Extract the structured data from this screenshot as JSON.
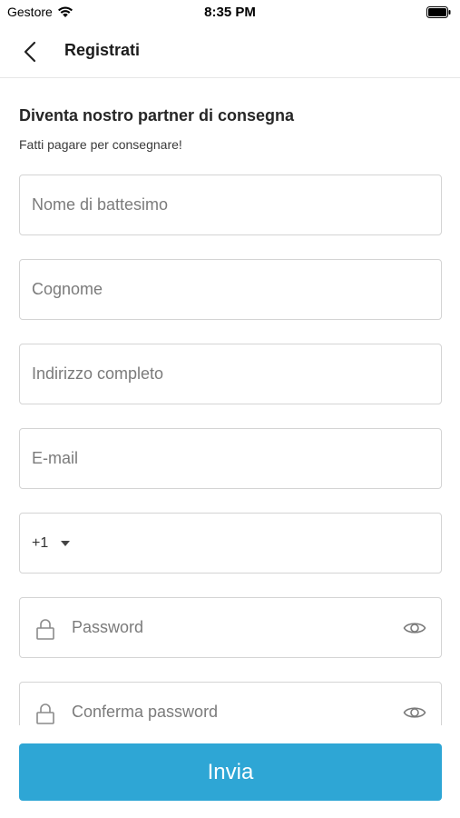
{
  "status_bar": {
    "carrier": "Gestore",
    "time": "8:35 PM"
  },
  "nav": {
    "title": "Registrati"
  },
  "form": {
    "heading": "Diventa nostro partner di consegna",
    "subheading": "Fatti pagare per consegnare!",
    "first_name": {
      "placeholder": "Nome di battesimo",
      "value": ""
    },
    "last_name": {
      "placeholder": "Cognome",
      "value": ""
    },
    "address": {
      "placeholder": "Indirizzo completo",
      "value": ""
    },
    "email": {
      "placeholder": "E-mail",
      "value": ""
    },
    "phone": {
      "country_code": "+1",
      "value": ""
    },
    "password": {
      "placeholder": "Password",
      "value": ""
    },
    "confirm_password": {
      "placeholder": "Conferma password",
      "value": ""
    }
  },
  "actions": {
    "submit_label": "Invia"
  },
  "colors": {
    "accent": "#2ea6d5",
    "field_border": "#d4d4d4"
  },
  "icons": [
    "wifi-icon",
    "battery-icon",
    "back-arrow-icon",
    "lock-icon",
    "eye-icon",
    "caret-down-icon"
  ]
}
